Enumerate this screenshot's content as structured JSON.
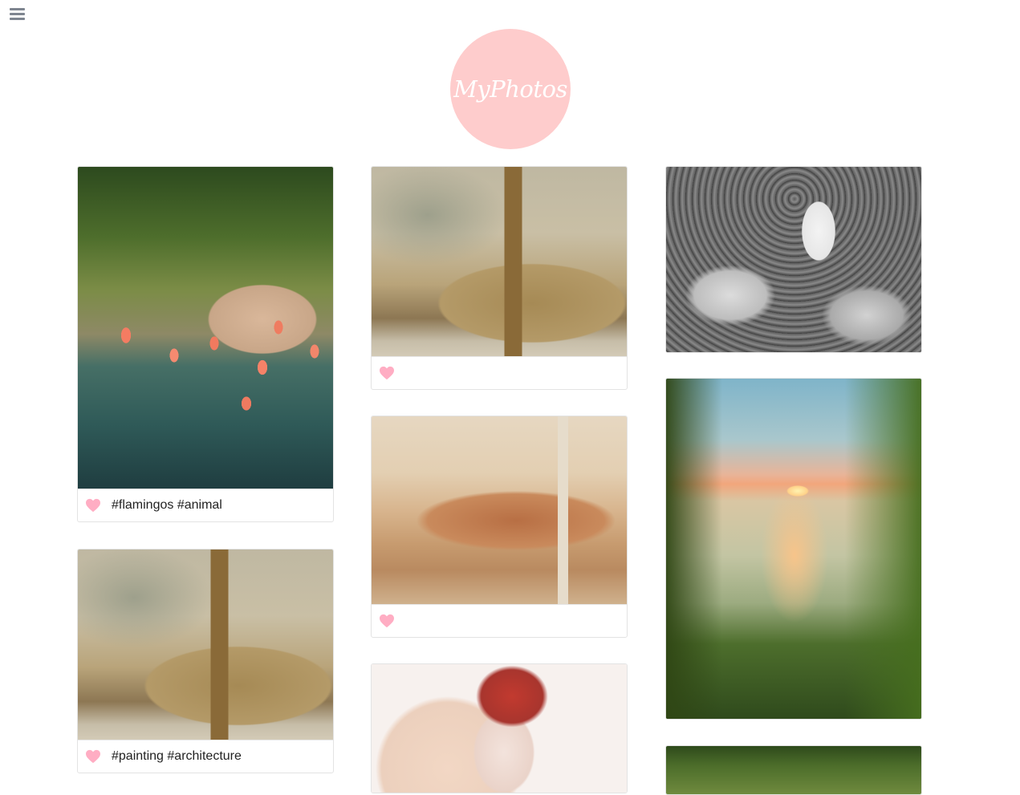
{
  "app": {
    "logo_text": "MyPhotos",
    "menu_icon": "hamburger-menu-icon",
    "accent_color": "#fecccc",
    "heart_color": "#ffadc3"
  },
  "posts": [
    {
      "image": "flamingos in a tropical pond",
      "tags": "#flamingos #animal",
      "liked_icon": "heart-icon"
    },
    {
      "image": "watercolor of a church tower",
      "tags": "#painting #architecture",
      "liked_icon": "heart-icon"
    },
    {
      "image": "watercolor of a church tower",
      "tags": "",
      "liked_icon": "heart-icon"
    },
    {
      "image": "watercolor of old town with column",
      "tags": "",
      "liked_icon": "heart-icon"
    },
    {
      "image": "watercolor portrait with red hair",
      "tags": ""
    },
    {
      "image": "black and white conductor with orchestra"
    },
    {
      "image": "sunset over a lake with flowers"
    },
    {
      "image": "palm trees"
    }
  ]
}
